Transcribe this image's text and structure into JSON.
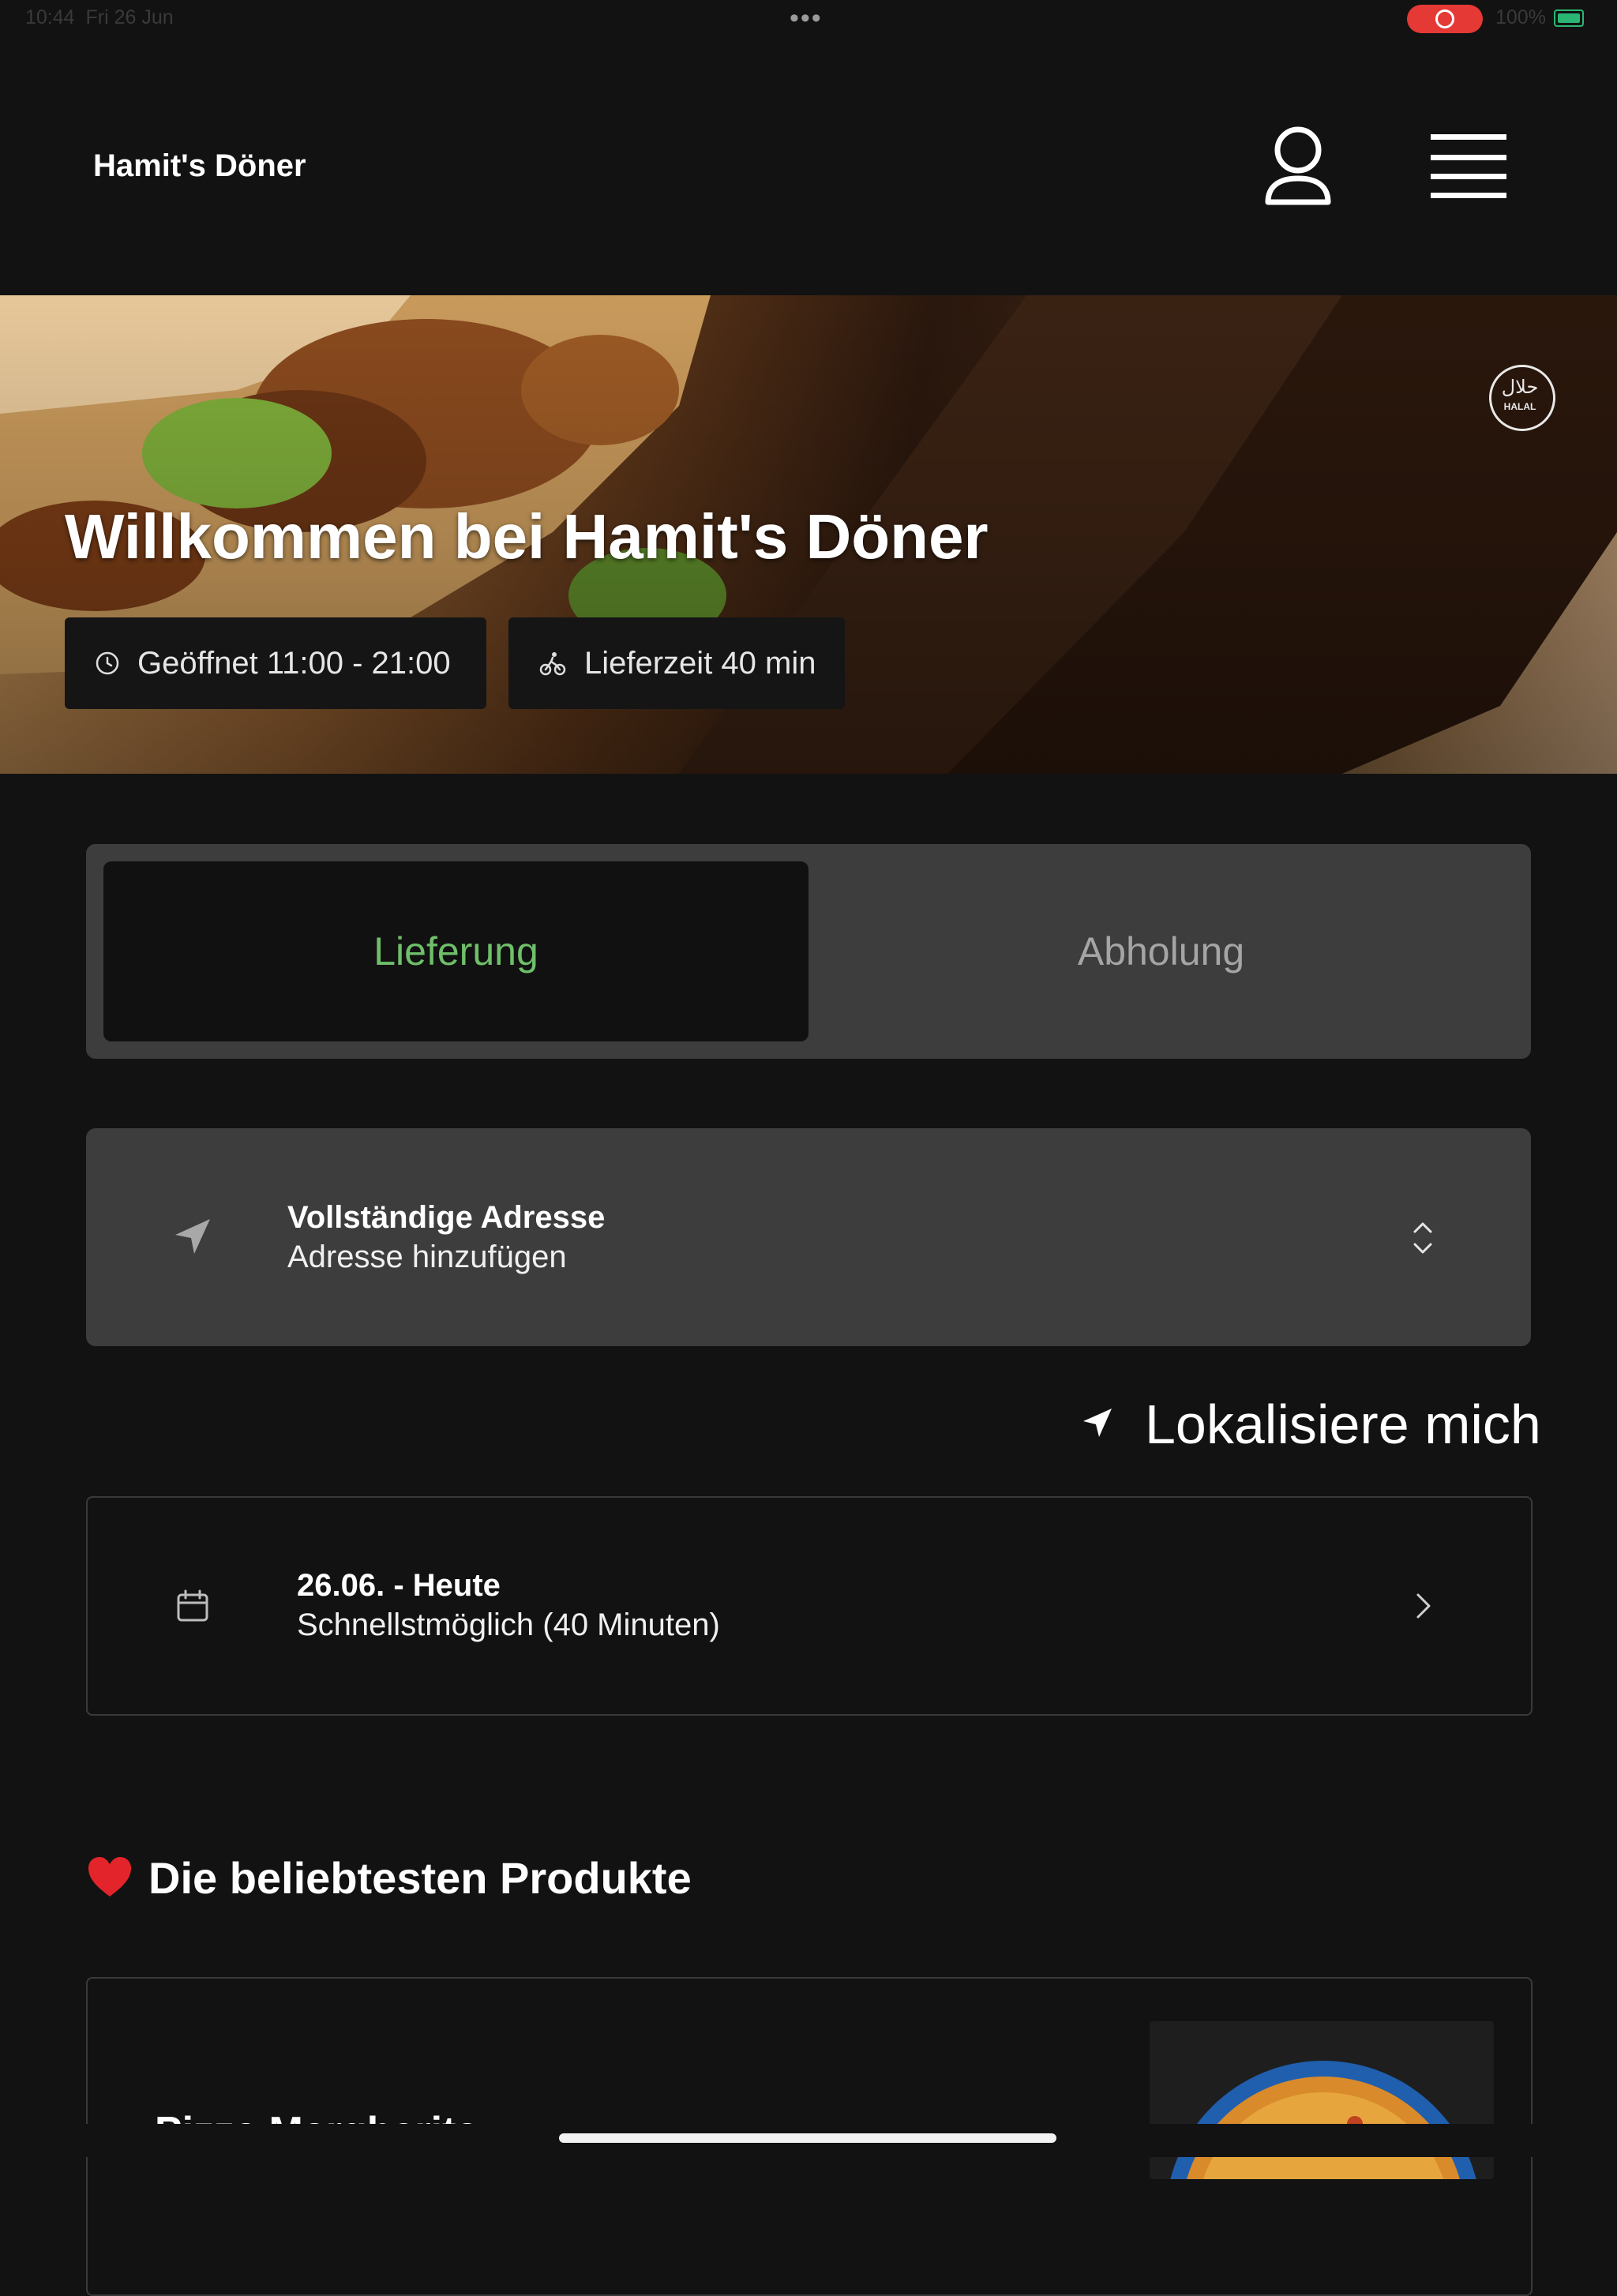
{
  "status_bar": {
    "time": "10:44",
    "date": "Fri 26 Jun",
    "dots": "•••",
    "battery": "100%"
  },
  "header": {
    "brand": "Hamit's Döner",
    "icons": [
      "user-icon",
      "menu-icon"
    ]
  },
  "hero": {
    "title": "Willkommen bei Hamit's Döner",
    "opening_hours": "Geöffnet 11:00 - 21:00",
    "delivery_time": "Lieferzeit 40 min",
    "halal_ar": "حلال",
    "halal_en": "HALAL"
  },
  "mode_selector": {
    "options": [
      "Lieferung",
      "Abholung"
    ],
    "selected": "Lieferung",
    "active_color": "#6fbf6a"
  },
  "address": {
    "title": "Vollständige Adresse",
    "placeholder": "Adresse hinzufügen"
  },
  "locate": {
    "label": "Lokalisiere mich"
  },
  "schedule": {
    "title": "26.06. - Heute",
    "subtitle": "Schnellstmöglich (40 Minuten)"
  },
  "popular": {
    "title": "Die beliebtesten Produkte",
    "products": [
      {
        "name": "Pizza Margherita"
      }
    ]
  },
  "colors": {
    "background": "#121212",
    "card": "#3d3d3d",
    "accent": "#6fbf6a",
    "record": "#e53935"
  }
}
